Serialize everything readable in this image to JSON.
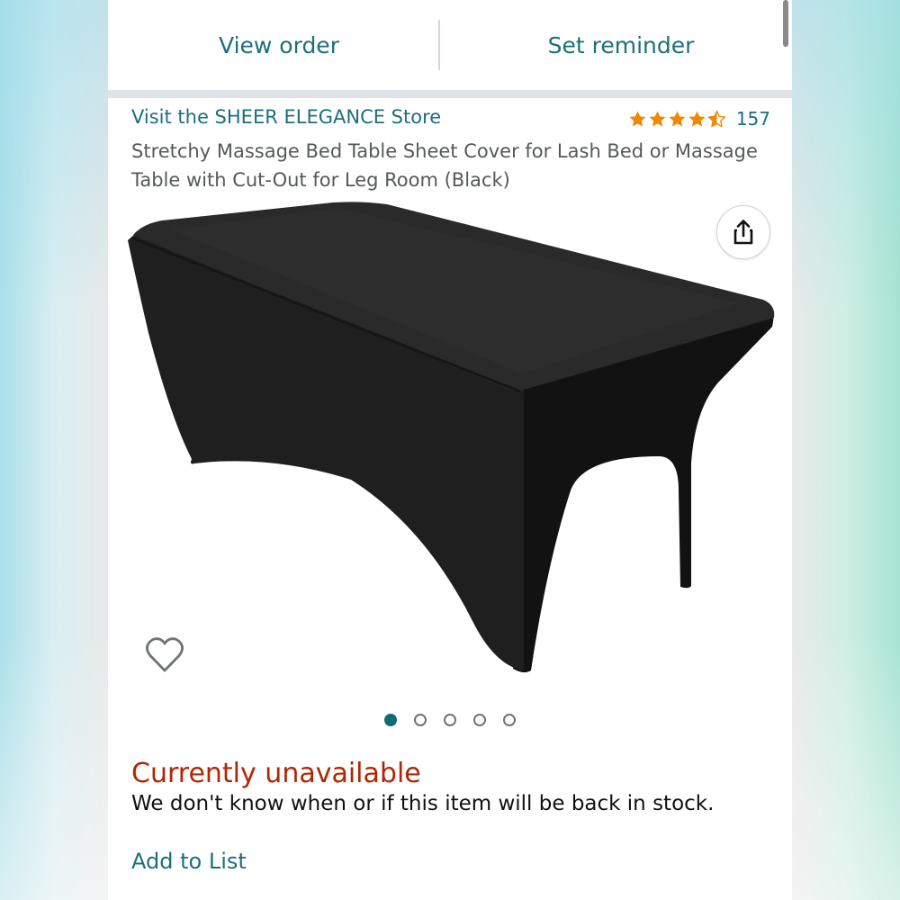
{
  "top_actions": {
    "view_order": "View order",
    "set_reminder": "Set reminder"
  },
  "product": {
    "store_link": "Visit the SHEER ELEGANCE Store",
    "rating_value": 4.5,
    "rating_count": "157",
    "title": "Stretchy Massage Bed Table Sheet Cover for Lash Bed or Massage Table with Cut-Out for Leg Room (Black)",
    "image_icon": "black-table-cover-image",
    "image_count": 5,
    "active_image_index": 0
  },
  "icons": {
    "share": "share-icon",
    "favorite": "heart-icon",
    "star": "star-icon"
  },
  "availability": {
    "status": "Currently unavailable",
    "message": "We don't know when or if this item will be back in stock."
  },
  "actions": {
    "add_to_list": "Add to List"
  },
  "colors": {
    "link": "#1b6f7b",
    "unavailable": "#b12704",
    "star": "#f08804",
    "dot_active": "#0f6b77"
  }
}
